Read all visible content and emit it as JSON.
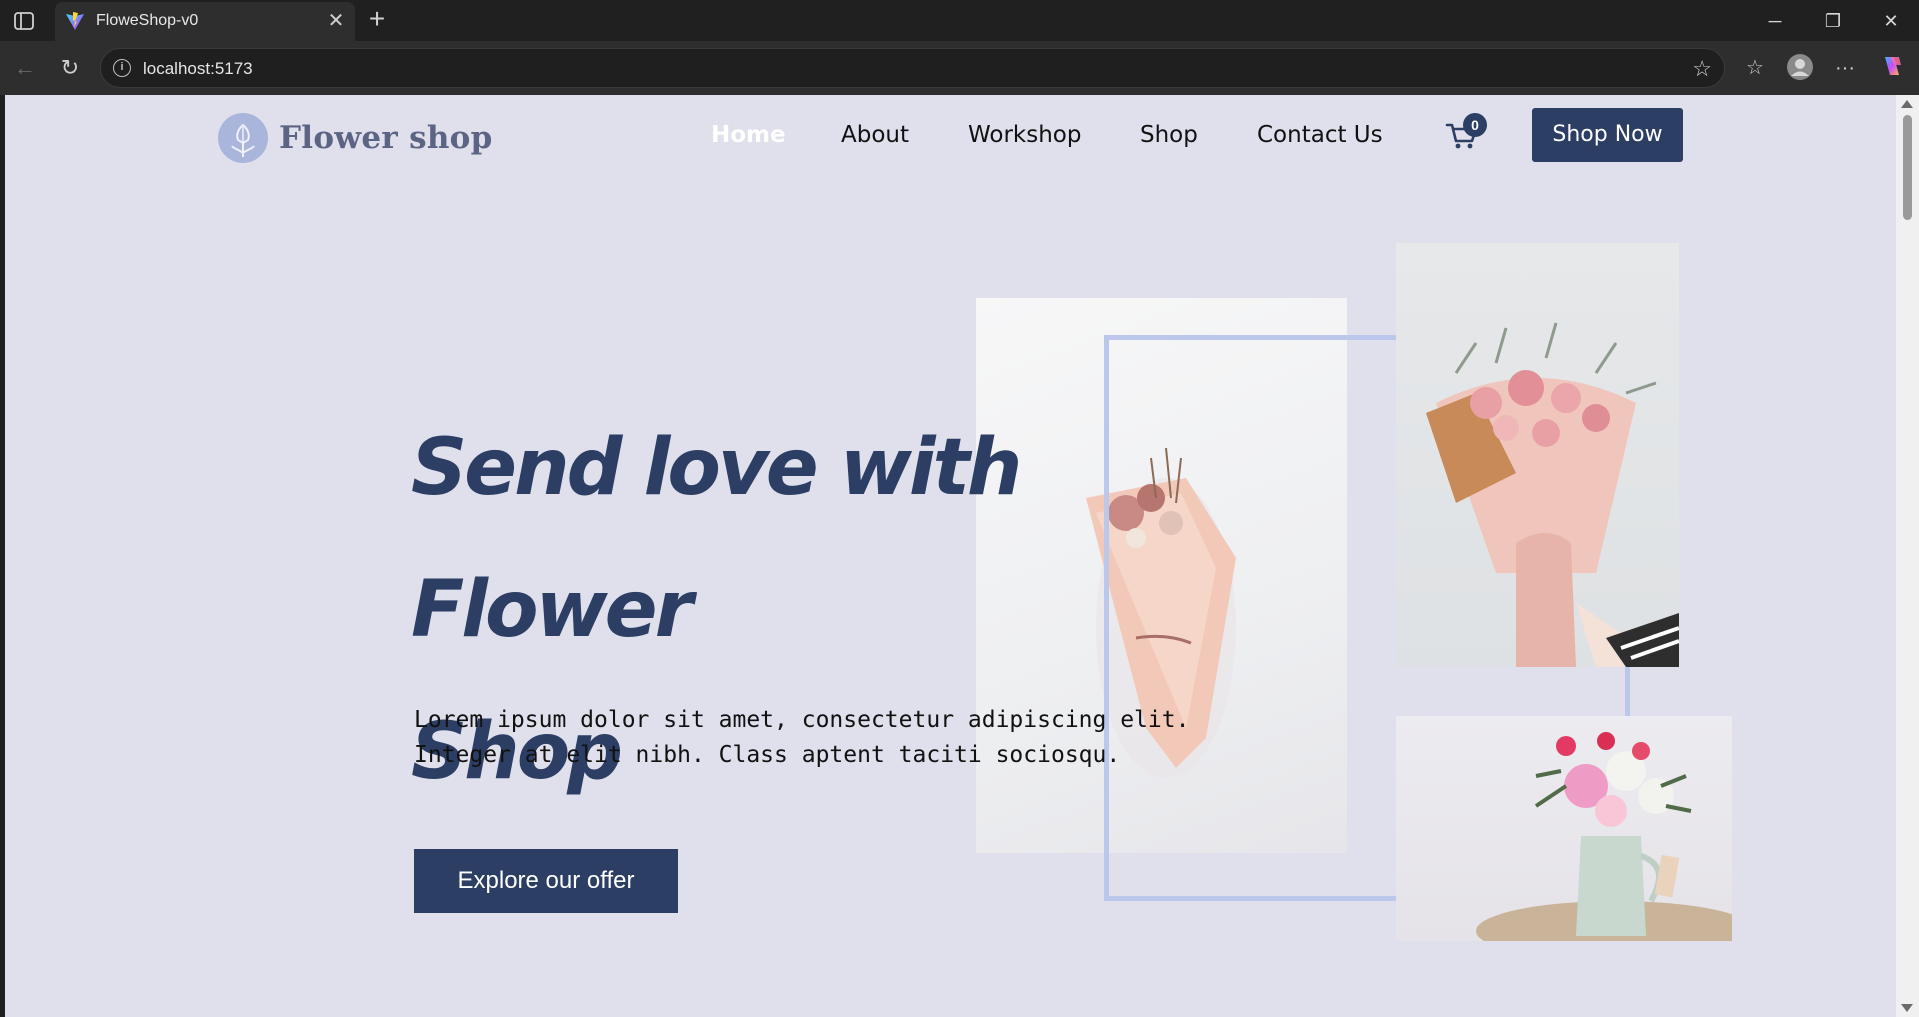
{
  "browser": {
    "tab_title": "FloweShop-v0",
    "url": "localhost:5173"
  },
  "header": {
    "logo_text": "Flower shop",
    "nav": [
      "Home",
      "About",
      "Workshop",
      "Shop",
      "Contact Us"
    ],
    "active_nav": "Home",
    "cart_count": "0",
    "cta_label": "Shop Now"
  },
  "hero": {
    "title_line1": "Send love with Flower",
    "title_line2": "Shop",
    "description": "Lorem ipsum dolor sit amet, consectetur adipiscing elit. Integer at elit nibh. Class aptent taciti sociosqu.",
    "button_label": "Explore our offer"
  },
  "colors": {
    "brand": "#2c3e63",
    "page_bg": "#dfe0ec",
    "frame": "#bcc7ec"
  },
  "icons": [
    "sidebar-toggle-icon",
    "vite-favicon-icon",
    "close-icon",
    "plus-icon",
    "minimize-icon",
    "restore-icon",
    "back-icon",
    "refresh-icon",
    "info-icon",
    "star-icon",
    "favorites-icon",
    "profile-icon",
    "more-icon",
    "copilot-icon",
    "cart-icon"
  ]
}
